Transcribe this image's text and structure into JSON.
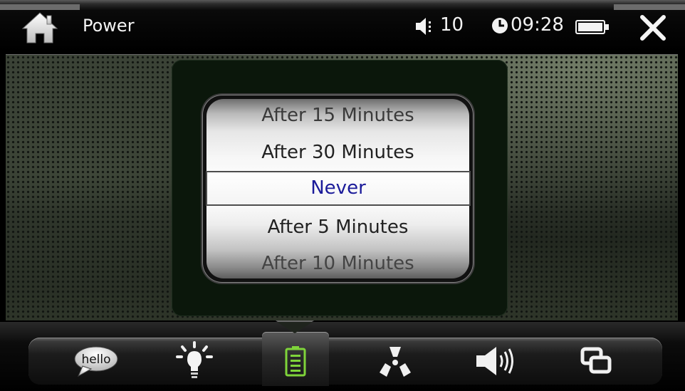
{
  "header": {
    "title": "Power",
    "volume": "10",
    "time": "09:28"
  },
  "power_picker": {
    "options": [
      "After 15 Minutes",
      "After 30 Minutes",
      "Never",
      "After 5 Minutes",
      "After 10 Minutes"
    ],
    "selected": "Never"
  },
  "dock": {
    "hello_label": "hello",
    "items": [
      "hello-icon",
      "brightness-icon",
      "battery-icon",
      "radiation-icon",
      "volume-icon",
      "windows-icon"
    ],
    "active": "battery-icon"
  },
  "colors": {
    "selected_text": "#1b1b9a",
    "active_icon": "#7fd43a",
    "panel": "#0b170b"
  }
}
